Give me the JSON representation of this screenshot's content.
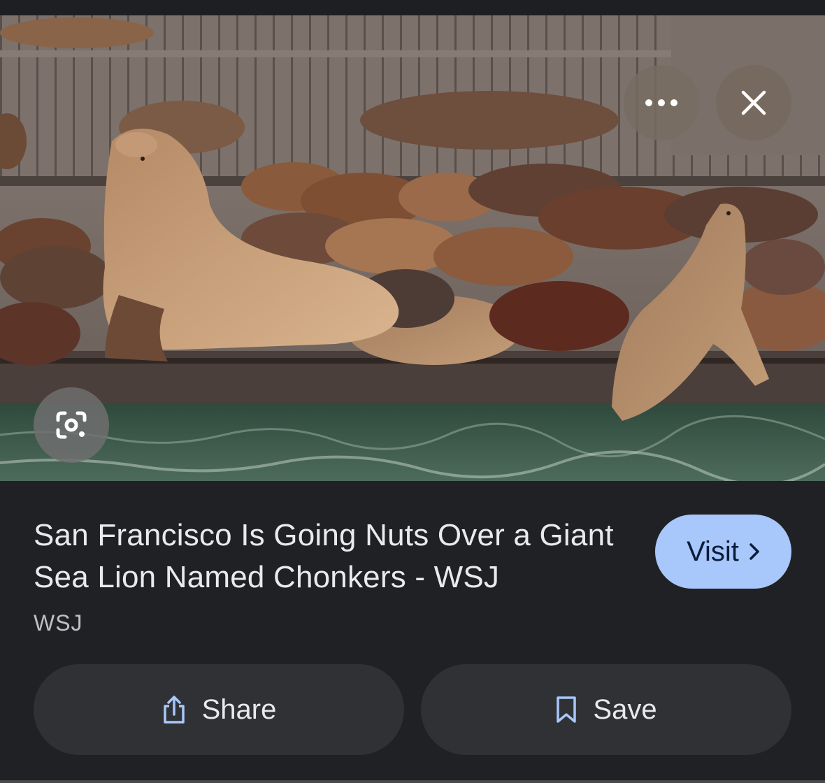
{
  "image": {
    "alt_subject": "sea lions on docks",
    "actions": {
      "more_icon": "more-horizontal-icon",
      "close_icon": "close-icon",
      "lens_icon": "lens-icon"
    }
  },
  "result": {
    "title": "San Francisco Is Going Nuts Over a Giant Sea Lion Named Chonkers - WSJ",
    "source": "WSJ",
    "visit_label": "Visit",
    "visit_icon": "chevron-right-icon"
  },
  "actions": {
    "share_label": "Share",
    "share_icon": "share-icon",
    "save_label": "Save",
    "save_icon": "bookmark-icon"
  },
  "colors": {
    "background": "#202124",
    "visit_button": "#a8c7fa",
    "action_button": "#303134",
    "icon_accent": "#a8c7fa",
    "text_primary": "#e8eaed"
  }
}
